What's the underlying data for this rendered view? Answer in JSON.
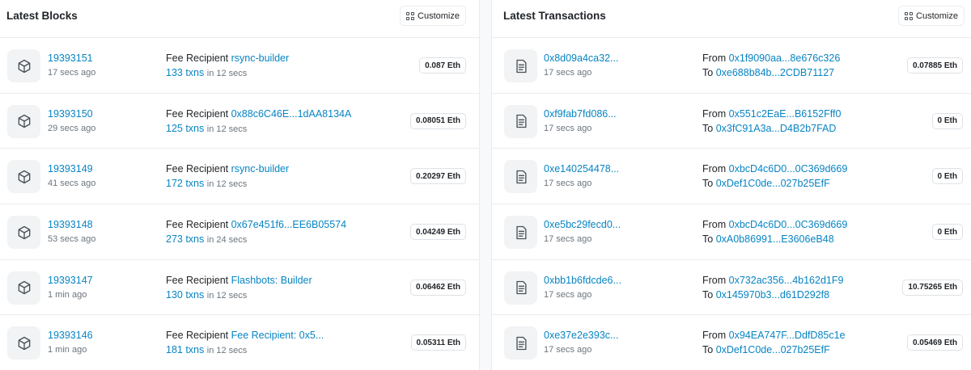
{
  "blocks": {
    "title": "Latest Blocks",
    "customize_label": "Customize",
    "rows": [
      {
        "number": "19393151",
        "age": "17 secs ago",
        "fee_label": "Fee Recipient",
        "recipient": "rsync-builder",
        "txns": "133 txns",
        "time": "in 12 secs",
        "reward": "0.087 Eth"
      },
      {
        "number": "19393150",
        "age": "29 secs ago",
        "fee_label": "Fee Recipient",
        "recipient": "0x88c6C46E...1dAA8134A",
        "txns": "125 txns",
        "time": "in 12 secs",
        "reward": "0.08051 Eth"
      },
      {
        "number": "19393149",
        "age": "41 secs ago",
        "fee_label": "Fee Recipient",
        "recipient": "rsync-builder",
        "txns": "172 txns",
        "time": "in 12 secs",
        "reward": "0.20297 Eth"
      },
      {
        "number": "19393148",
        "age": "53 secs ago",
        "fee_label": "Fee Recipient",
        "recipient": "0x67e451f6...EE6B05574",
        "txns": "273 txns",
        "time": "in 24 secs",
        "reward": "0.04249 Eth"
      },
      {
        "number": "19393147",
        "age": "1 min ago",
        "fee_label": "Fee Recipient",
        "recipient": "Flashbots: Builder",
        "txns": "130 txns",
        "time": "in 12 secs",
        "reward": "0.06462 Eth"
      },
      {
        "number": "19393146",
        "age": "1 min ago",
        "fee_label": "Fee Recipient",
        "recipient": "Fee Recipient: 0x5...",
        "txns": "181 txns",
        "time": "in 12 secs",
        "reward": "0.05311 Eth"
      }
    ]
  },
  "transactions": {
    "title": "Latest Transactions",
    "customize_label": "Customize",
    "rows": [
      {
        "hash": "0x8d09a4ca32...",
        "age": "17 secs ago",
        "from_label": "From",
        "from": "0x1f9090aa...8e676c326",
        "to_label": "To",
        "to": "0xe688b84b...2CDB71127",
        "value": "0.07885 Eth"
      },
      {
        "hash": "0xf9fab7fd086...",
        "age": "17 secs ago",
        "from_label": "From",
        "from": "0x551c2EaE...B6152Fff0",
        "to_label": "To",
        "to": "0x3fC91A3a...D4B2b7FAD",
        "value": "0 Eth"
      },
      {
        "hash": "0xe140254478...",
        "age": "17 secs ago",
        "from_label": "From",
        "from": "0xbcD4c6D0...0C369d669",
        "to_label": "To",
        "to": "0xDef1C0de...027b25EfF",
        "value": "0 Eth"
      },
      {
        "hash": "0xe5bc29fecd0...",
        "age": "17 secs ago",
        "from_label": "From",
        "from": "0xbcD4c6D0...0C369d669",
        "to_label": "To",
        "to": "0xA0b86991...E3606eB48",
        "value": "0 Eth"
      },
      {
        "hash": "0xbb1b6fdcde6...",
        "age": "17 secs ago",
        "from_label": "From",
        "from": "0x732ac356...4b162d1F9",
        "to_label": "To",
        "to": "0x145970b3...d61D292f8",
        "value": "10.75265 Eth"
      },
      {
        "hash": "0xe37e2e393c...",
        "age": "17 secs ago",
        "from_label": "From",
        "from": "0x94EA747F...DdfD85c1e",
        "to_label": "To",
        "to": "0xDef1C0de...027b25EfF",
        "value": "0.05469 Eth"
      }
    ]
  },
  "icons": {
    "block": "cube-icon",
    "transaction": "document-icon",
    "customize": "grid-icon"
  },
  "colors": {
    "link": "#0784c3",
    "muted": "#6c757d",
    "border": "#e9ecef",
    "icon_bg": "#f1f3f5"
  }
}
